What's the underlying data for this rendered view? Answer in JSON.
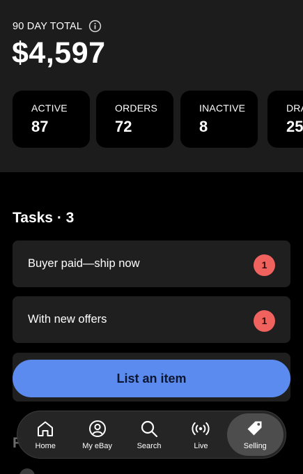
{
  "summary": {
    "total_label": "90 DAY TOTAL",
    "total_amount": "$4,597",
    "stats": [
      {
        "label": "ACTIVE",
        "value": "87"
      },
      {
        "label": "ORDERS",
        "value": "72"
      },
      {
        "label": "INACTIVE",
        "value": "8"
      },
      {
        "label": "DRA",
        "value": "25"
      }
    ]
  },
  "tasks": {
    "title": "Tasks · 3",
    "items": [
      {
        "label": "Buyer paid—ship now",
        "count": "1"
      },
      {
        "label": "With new offers",
        "count": "1"
      }
    ]
  },
  "list_item_button": "List an item",
  "behind_section_initial": "F",
  "tabbar": {
    "tabs": [
      {
        "label": "Home",
        "icon": "home-icon",
        "active": false
      },
      {
        "label": "My eBay",
        "icon": "user-icon",
        "active": false
      },
      {
        "label": "Search",
        "icon": "search-icon",
        "active": false
      },
      {
        "label": "Live",
        "icon": "live-icon",
        "active": false
      },
      {
        "label": "Selling",
        "icon": "tag-icon",
        "active": true
      }
    ]
  },
  "colors": {
    "summary_bg": "#1c1c1c",
    "card_bg": "#1f1f1f",
    "badge": "#f0625e",
    "primary_button": "#5b8bee"
  }
}
